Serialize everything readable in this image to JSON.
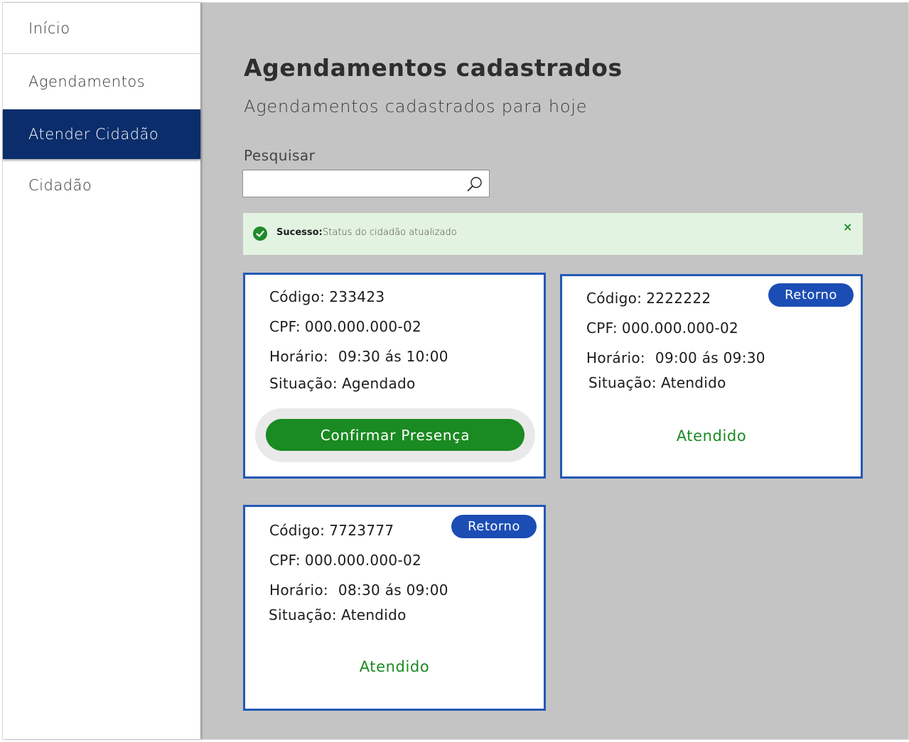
{
  "sidebar": {
    "items": [
      {
        "label": "Início"
      },
      {
        "label": "Agendamentos"
      },
      {
        "label": "Atender Cidadão"
      },
      {
        "label": "Cidadão"
      }
    ]
  },
  "main": {
    "title": "Agendamentos cadastrados",
    "subtitle": "Agendamentos cadastrados para hoje",
    "search": {
      "label": "Pesquisar",
      "value": "",
      "placeholder": ""
    },
    "alert": {
      "title": "Sucesso:",
      "message": "Status do cidadão atualizado",
      "close": "×"
    }
  },
  "cards": [
    {
      "code_label": "Código:",
      "code": "233423",
      "cpf_label": "CPF:",
      "cpf": "000.000.000-02",
      "time_label": "Horário:",
      "time": "09:30 ás 10:00",
      "status_label": "Situação:",
      "status": "Agendado",
      "action": "Confirmar Presença"
    },
    {
      "badge": "Retorno",
      "code_label": "Código:",
      "code": "2222222",
      "cpf_label": "CPF:",
      "cpf": "000.000.000-02",
      "time_label": "Horário:",
      "time": "09:00 ás 09:30",
      "status_label": "Situação:",
      "status": "Atendido",
      "result": "Atendido"
    },
    {
      "badge": "Retorno",
      "code_label": "Código:",
      "code": "7723777",
      "cpf_label": "CPF:",
      "cpf": "000.000.000-02",
      "time_label": "Horário:",
      "time": "08:30 ás 09:00",
      "status_label": "Situação:",
      "status": "Atendido",
      "result": "Atendido"
    }
  ],
  "colors": {
    "nav_active": "#0b2d6b",
    "card_border": "#2459b5",
    "badge": "#1c4db5",
    "success": "#1a8a22",
    "alert_bg": "#e3f3e1",
    "main_bg": "#c4c4c4"
  },
  "icons": {
    "search": "search-icon",
    "alert": "check-circle-icon",
    "close": "close-icon"
  }
}
